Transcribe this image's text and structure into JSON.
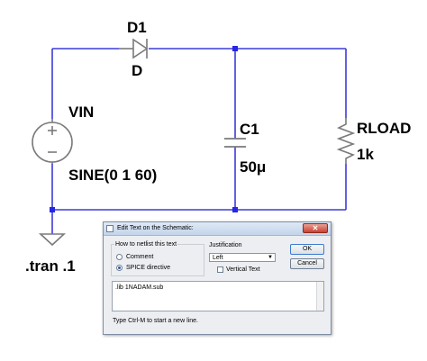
{
  "schematic": {
    "diode": {
      "ref": "D1",
      "value": "D"
    },
    "source": {
      "ref": "VIN",
      "value": "SINE(0 1 60)"
    },
    "capacitor": {
      "ref": "C1",
      "value": "50μ"
    },
    "load": {
      "ref": "RLOAD",
      "value": "1k"
    },
    "directive": ".tran .1",
    "colors": {
      "wire": "#3b3bd8",
      "junction": "#2626e6",
      "component": "#7a7a7a"
    }
  },
  "dialog": {
    "title": "Edit Text on the Schematic:",
    "netlist_group_label": "How to netlist this text",
    "option_comment": "Comment",
    "option_spice": "SPICE directive",
    "selected_option": "SPICE directive",
    "justification_label": "Justification",
    "justification_value": "Left",
    "vertical_text_label": "Vertical Text",
    "vertical_text_checked": false,
    "ok_label": "OK",
    "cancel_label": "Cancel",
    "text_content": ".lib 1NADAM.sub",
    "hint": "Type Ctrl-M to start a new line."
  }
}
